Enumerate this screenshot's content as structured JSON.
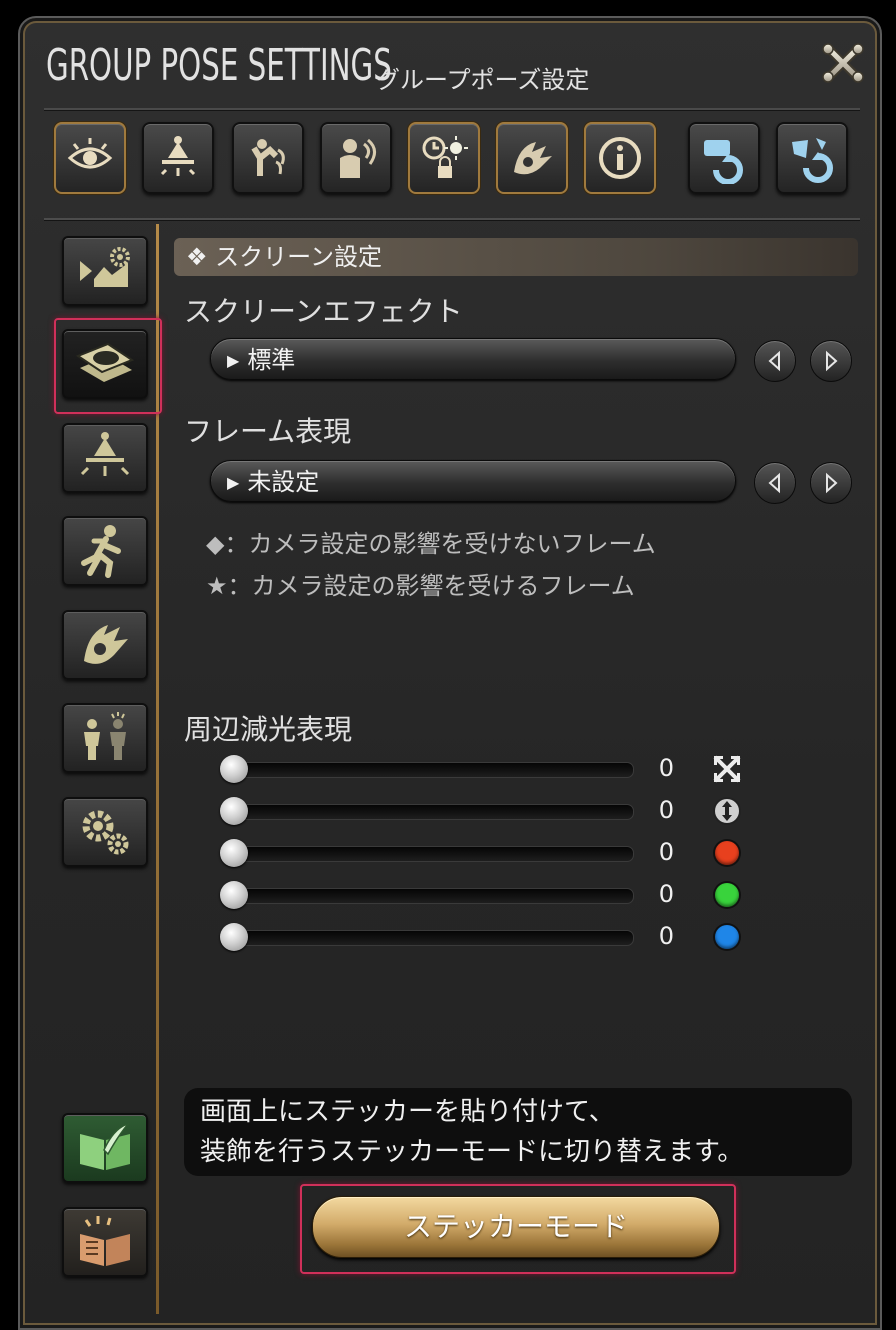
{
  "window": {
    "title_en": "GROUP POSE SETTINGS",
    "title_jp": "グループポーズ設定"
  },
  "toolbar": {
    "icons": [
      "eye-icon",
      "light-icon",
      "pose-icon",
      "face-icon",
      "time-lock-icon",
      "effect-icon",
      "info-icon",
      "undo-icon",
      "reset-icon"
    ]
  },
  "sidebar": {
    "icons": [
      "motion-settings-icon",
      "screen-frame-icon",
      "lighting-icon",
      "character-motion-icon",
      "effect-icon",
      "characters-icon",
      "settings-gears-icon",
      "sticker-book-icon",
      "guide-book-icon"
    ],
    "selected": "screen-frame-icon"
  },
  "section": {
    "header": "❖ スクリーン設定"
  },
  "screen_effect": {
    "label": "スクリーンエフェクト",
    "value": "標準"
  },
  "frame": {
    "label": "フレーム表現",
    "value": "未設定",
    "note1": "◆：カメラ設定の影響を受けないフレーム",
    "note2": "★：カメラ設定の影響を受けるフレーム"
  },
  "vignette": {
    "label": "周辺減光表現",
    "sliders": [
      {
        "value": "0",
        "icon": "expand-arrows-icon"
      },
      {
        "value": "0",
        "icon": "vertical-arrows-icon"
      },
      {
        "value": "0",
        "icon": "red-dot-icon",
        "color": "#e8401e"
      },
      {
        "value": "0",
        "icon": "green-dot-icon",
        "color": "#39d33c"
      },
      {
        "value": "0",
        "icon": "blue-dot-icon",
        "color": "#1f86e8"
      }
    ]
  },
  "tooltip": {
    "line1": "画面上にステッカーを貼り付けて、",
    "line2": "装飾を行うステッカーモードに切り替えます。"
  },
  "sticker_button": {
    "label": "ステッカーモード"
  }
}
